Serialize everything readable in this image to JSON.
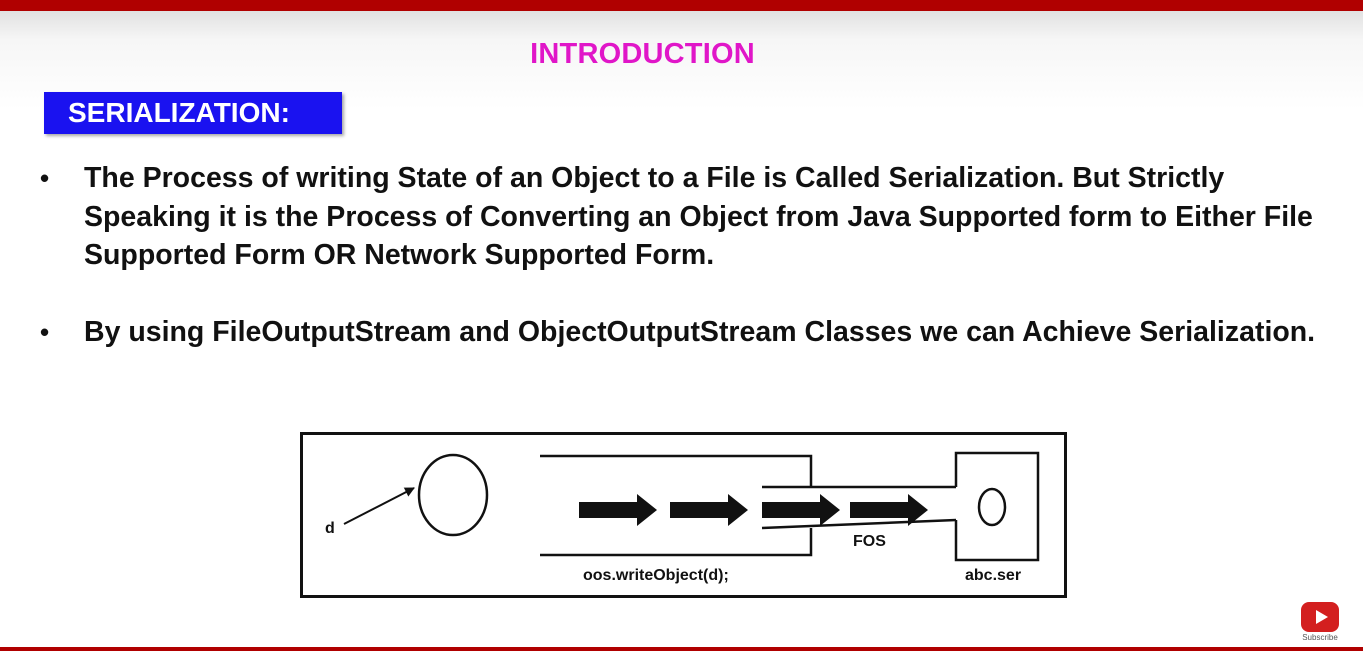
{
  "slide": {
    "title": "INTRODUCTION",
    "section_label": "SERIALIZATION:",
    "bullets": [
      {
        "marker": "•",
        "text": "The Process of writing State of an Object to a File is Called Serialization. But Strictly Speaking it is the Process of Converting an Object from Java Supported form to Either File Supported Form OR Network Supported Form."
      },
      {
        "marker": "•",
        "text": "By using FileOutputStream and ObjectOutputStream Classes we can Achieve Serialization."
      }
    ]
  },
  "diagram": {
    "reference_label": "d",
    "method_label": "oos.writeObject(d);",
    "stream_label": "FOS",
    "file_label": "abc.ser"
  },
  "subscribe_badge": {
    "icon": "youtube-play-icon",
    "label": "Subscribe",
    "color": "#d31f1f"
  },
  "colors": {
    "top_bar": "#b00000",
    "title": "#e016c8",
    "section_label_bg": "#1a12f0"
  }
}
